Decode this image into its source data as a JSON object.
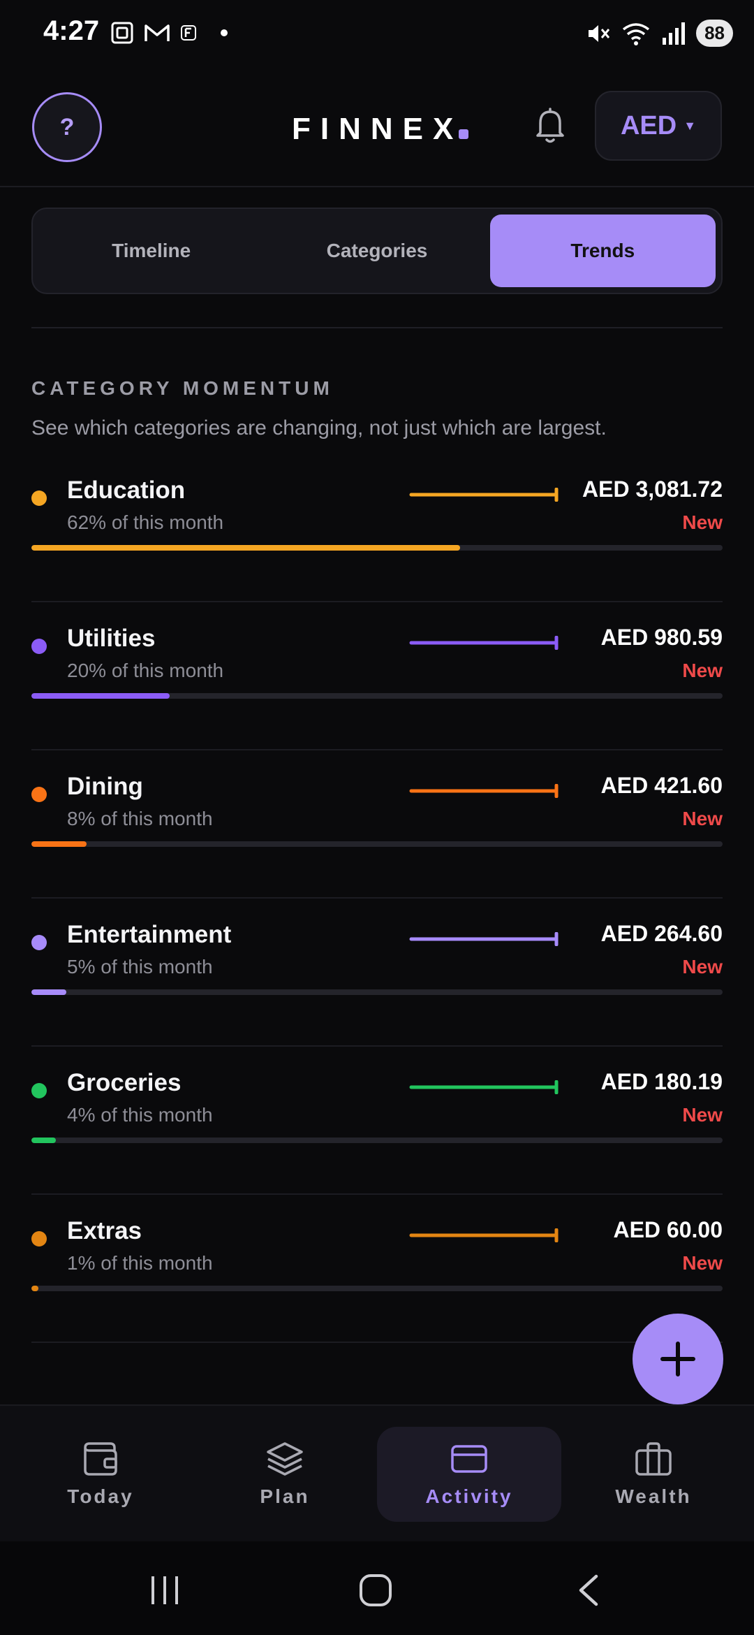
{
  "status_bar": {
    "time": "4:27",
    "battery": "88",
    "icons_left": [
      "screenshot-icon",
      "gmail-icon",
      "finnex-notification-icon"
    ],
    "icons_right": [
      "mute-icon",
      "wifi-icon",
      "signal-icon"
    ]
  },
  "header": {
    "help_label": "?",
    "logo_text": "FINNEX",
    "currency": "AED",
    "accent_color": "#a68cf7"
  },
  "tabs": [
    {
      "label": "Timeline",
      "active": false
    },
    {
      "label": "Categories",
      "active": false
    },
    {
      "label": "Trends",
      "active": true
    }
  ],
  "section": {
    "title": "CATEGORY MOMENTUM",
    "subtitle": "See which categories are changing, not just which are largest."
  },
  "categories": [
    {
      "name": "Education",
      "share_text": "62% of this month",
      "share": 0.62,
      "amount": "AED 3,081.72",
      "badge": "New",
      "color": "#f5a623"
    },
    {
      "name": "Utilities",
      "share_text": "20% of this month",
      "share": 0.2,
      "amount": "AED 980.59",
      "badge": "New",
      "color": "#8b5cf6"
    },
    {
      "name": "Dining",
      "share_text": "8% of this month",
      "share": 0.08,
      "amount": "AED 421.60",
      "badge": "New",
      "color": "#f97316"
    },
    {
      "name": "Entertainment",
      "share_text": "5% of this month",
      "share": 0.05,
      "amount": "AED 264.60",
      "badge": "New",
      "color": "#a78bfa"
    },
    {
      "name": "Groceries",
      "share_text": "4% of this month",
      "share": 0.035,
      "amount": "AED 180.19",
      "badge": "New",
      "color": "#22c55e"
    },
    {
      "name": "Extras",
      "share_text": "1% of this month",
      "share": 0.01,
      "amount": "AED 60.00",
      "badge": "New",
      "color": "#e38513"
    }
  ],
  "fab": {
    "icon": "plus-icon"
  },
  "bottom_nav": [
    {
      "label": "Today",
      "icon": "wallet-icon",
      "active": false
    },
    {
      "label": "Plan",
      "icon": "layers-icon",
      "active": false
    },
    {
      "label": "Activity",
      "icon": "card-icon",
      "active": true
    },
    {
      "label": "Wealth",
      "icon": "briefcase-icon",
      "active": false
    }
  ],
  "system_nav": [
    "recents-icon",
    "home-icon",
    "back-icon"
  ]
}
